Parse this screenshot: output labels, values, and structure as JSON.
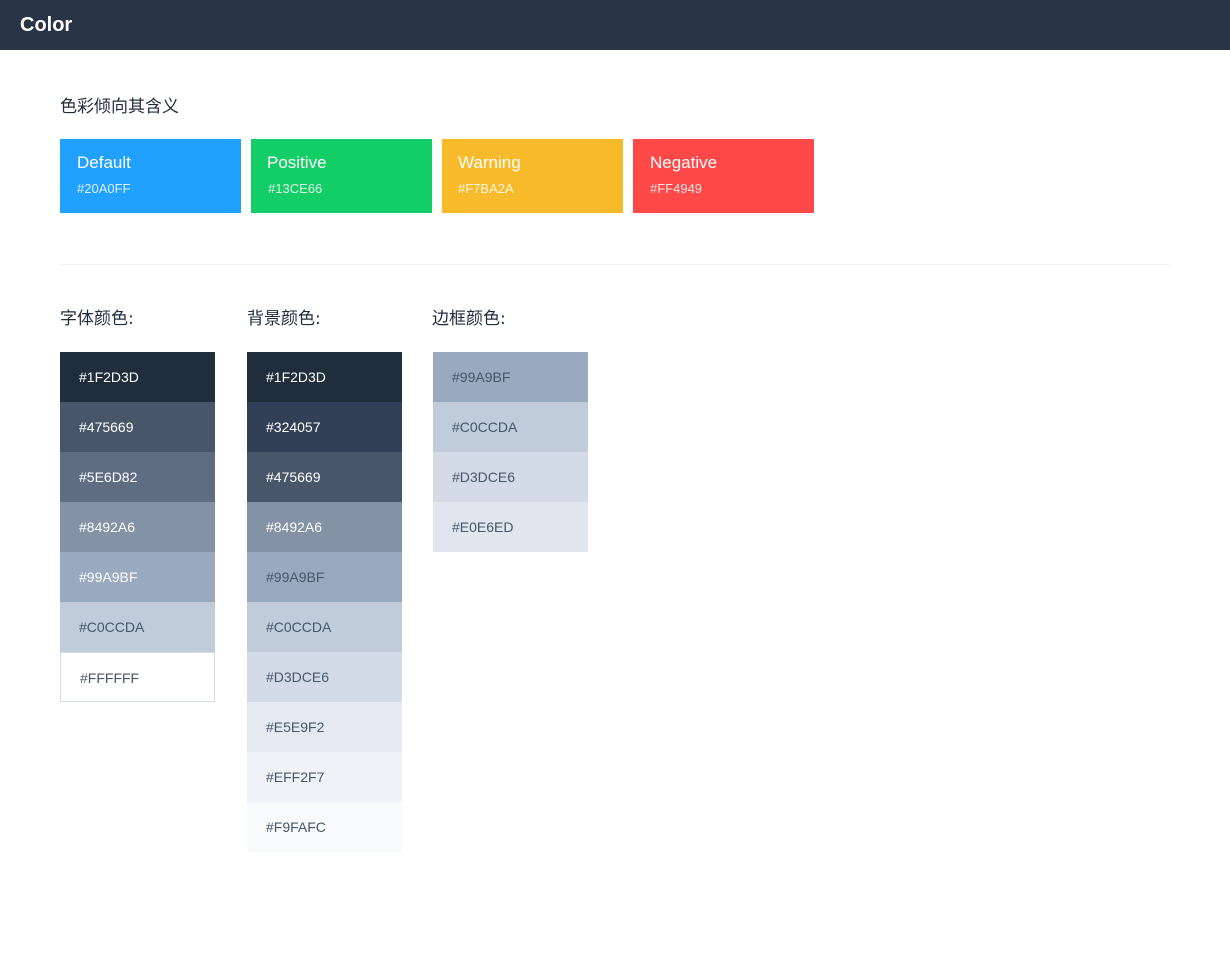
{
  "header": {
    "title": "Color"
  },
  "intent_section": {
    "heading": "色彩倾向其含义",
    "cards": [
      {
        "name": "Default",
        "hex": "#20A0FF",
        "color": "#20A0FF"
      },
      {
        "name": "Positive",
        "hex": "#13CE66",
        "color": "#13CE66"
      },
      {
        "name": "Warning",
        "hex": "#F7BA2A",
        "color": "#F7BA2A"
      },
      {
        "name": "Negative",
        "hex": "#FF4949",
        "color": "#FF4949"
      }
    ]
  },
  "font_colors": {
    "heading": "字体颜色:",
    "swatches": [
      {
        "label": "#1F2D3D",
        "color": "#1F2D3D",
        "text_color": "#FFFFFF"
      },
      {
        "label": "#475669",
        "color": "#475669",
        "text_color": "#FFFFFF"
      },
      {
        "label": "#5E6D82",
        "color": "#5E6D82",
        "text_color": "#FFFFFF"
      },
      {
        "label": "#8492A6",
        "color": "#8492A6",
        "text_color": "#FFFFFF"
      },
      {
        "label": "#99A9BF",
        "color": "#99A9BF",
        "text_color": "#FFFFFF"
      },
      {
        "label": "#C0CCDA",
        "color": "#C0CCDA",
        "text_color": "#475669"
      },
      {
        "label": "#FFFFFF",
        "color": "#FFFFFF",
        "text_color": "#475669"
      }
    ]
  },
  "background_colors": {
    "heading": "背景颜色:",
    "swatches": [
      {
        "label": "#1F2D3D",
        "color": "#1F2D3D",
        "text_color": "#FFFFFF"
      },
      {
        "label": "#324057",
        "color": "#324057",
        "text_color": "#FFFFFF"
      },
      {
        "label": "#475669",
        "color": "#475669",
        "text_color": "#FFFFFF"
      },
      {
        "label": "#8492A6",
        "color": "#8492A6",
        "text_color": "#FFFFFF"
      },
      {
        "label": "#99A9BF",
        "color": "#99A9BF",
        "text_color": "#475669"
      },
      {
        "label": "#C0CCDA",
        "color": "#C0CCDA",
        "text_color": "#475669"
      },
      {
        "label": "#D3DCE6",
        "color": "#D3DCE6",
        "text_color": "#475669"
      },
      {
        "label": "#E5E9F2",
        "color": "#E5E9F2",
        "text_color": "#475669"
      },
      {
        "label": "#EFF2F7",
        "color": "#EFF2F7",
        "text_color": "#475669"
      },
      {
        "label": "#F9FAFC",
        "color": "#F9FAFC",
        "text_color": "#475669"
      }
    ]
  },
  "border_colors": {
    "heading": "边框颜色:",
    "swatches": [
      {
        "label": "#99A9BF",
        "color": "#99A9BF",
        "text_color": "#475669"
      },
      {
        "label": "#C0CCDA",
        "color": "#C0CCDA",
        "text_color": "#475669"
      },
      {
        "label": "#D3DCE6",
        "color": "#D3DCE6",
        "text_color": "#475669"
      },
      {
        "label": "#E0E6ED",
        "color": "#E0E6ED",
        "text_color": "#475669"
      }
    ]
  }
}
